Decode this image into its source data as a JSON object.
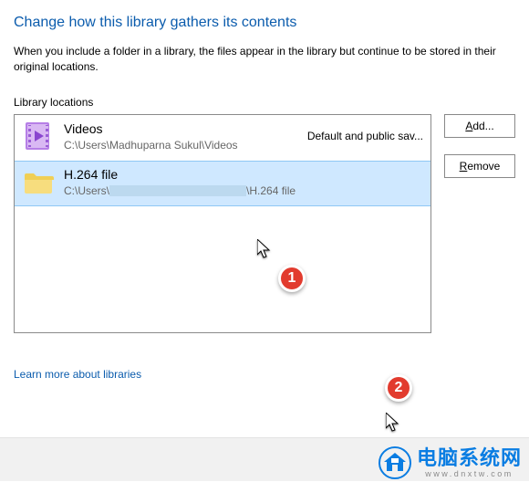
{
  "title": "Change how this library gathers its contents",
  "description": "When you include a folder in a library, the files appear in the library but continue to be stored in their original locations.",
  "section_label": "Library locations",
  "locations": [
    {
      "name": "Videos",
      "path": "C:\\Users\\Madhuparna Sukul\\Videos",
      "status": "Default and public sav...",
      "icon": "video-library-icon",
      "selected": false
    },
    {
      "name": "H.264 file",
      "path_prefix": "C:\\Users\\",
      "path_suffix": "\\H.264 file",
      "status": "",
      "icon": "folder-icon",
      "selected": true,
      "redacted_segment": true
    }
  ],
  "buttons": {
    "add_prefix": "A",
    "add_rest": "dd...",
    "remove_prefix": "R",
    "remove_rest": "emove"
  },
  "learn_more": "Learn more about libraries",
  "annotations": {
    "marker1": "1",
    "marker2": "2"
  },
  "brand": {
    "cn": "电脑系统网",
    "url": "www.dnxtw.com"
  }
}
